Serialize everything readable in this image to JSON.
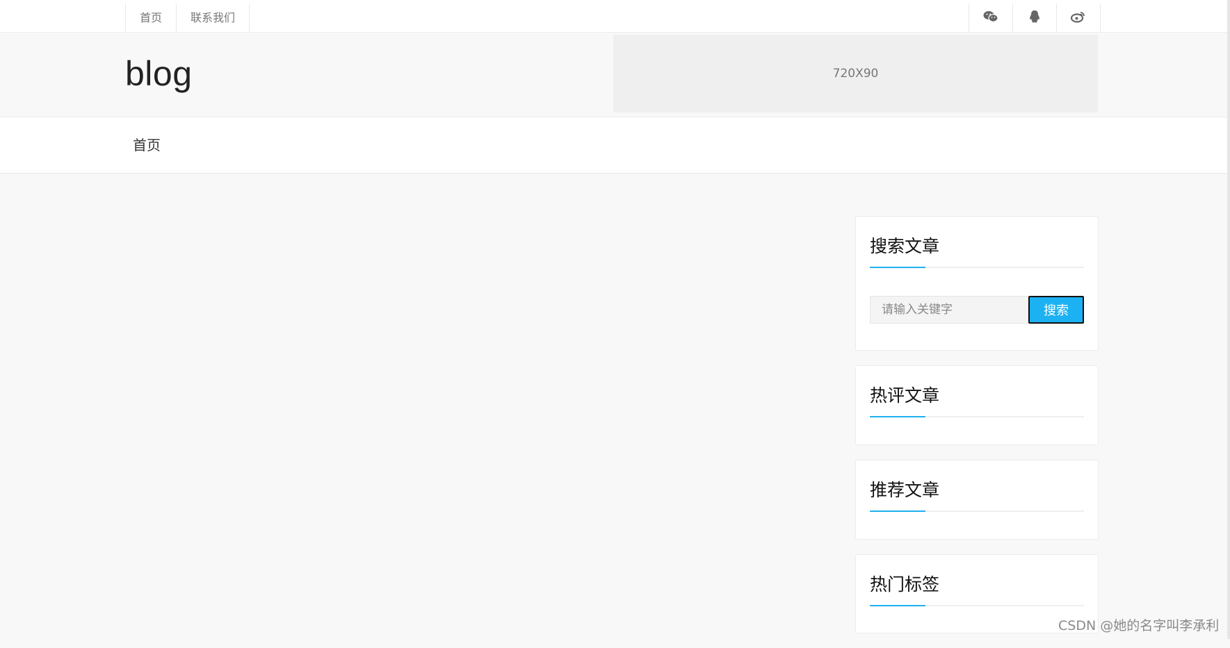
{
  "topbar": {
    "nav": [
      "首页",
      "联系我们"
    ],
    "social_icons": [
      "wechat-icon",
      "qq-icon",
      "weibo-icon"
    ]
  },
  "header": {
    "logo": "blog",
    "ad_label": "720X90"
  },
  "mainnav": {
    "items": [
      "首页"
    ]
  },
  "sidebar": {
    "search": {
      "title": "搜索文章",
      "placeholder": "请输入关键字",
      "button": "搜索"
    },
    "hot_comments": {
      "title": "热评文章"
    },
    "recommended": {
      "title": "推荐文章"
    },
    "hot_tags": {
      "title": "热门标签"
    }
  },
  "watermark": "CSDN @她的名字叫李承利",
  "colors": {
    "accent": "#1cb1f2",
    "background": "#f8f8f8"
  }
}
